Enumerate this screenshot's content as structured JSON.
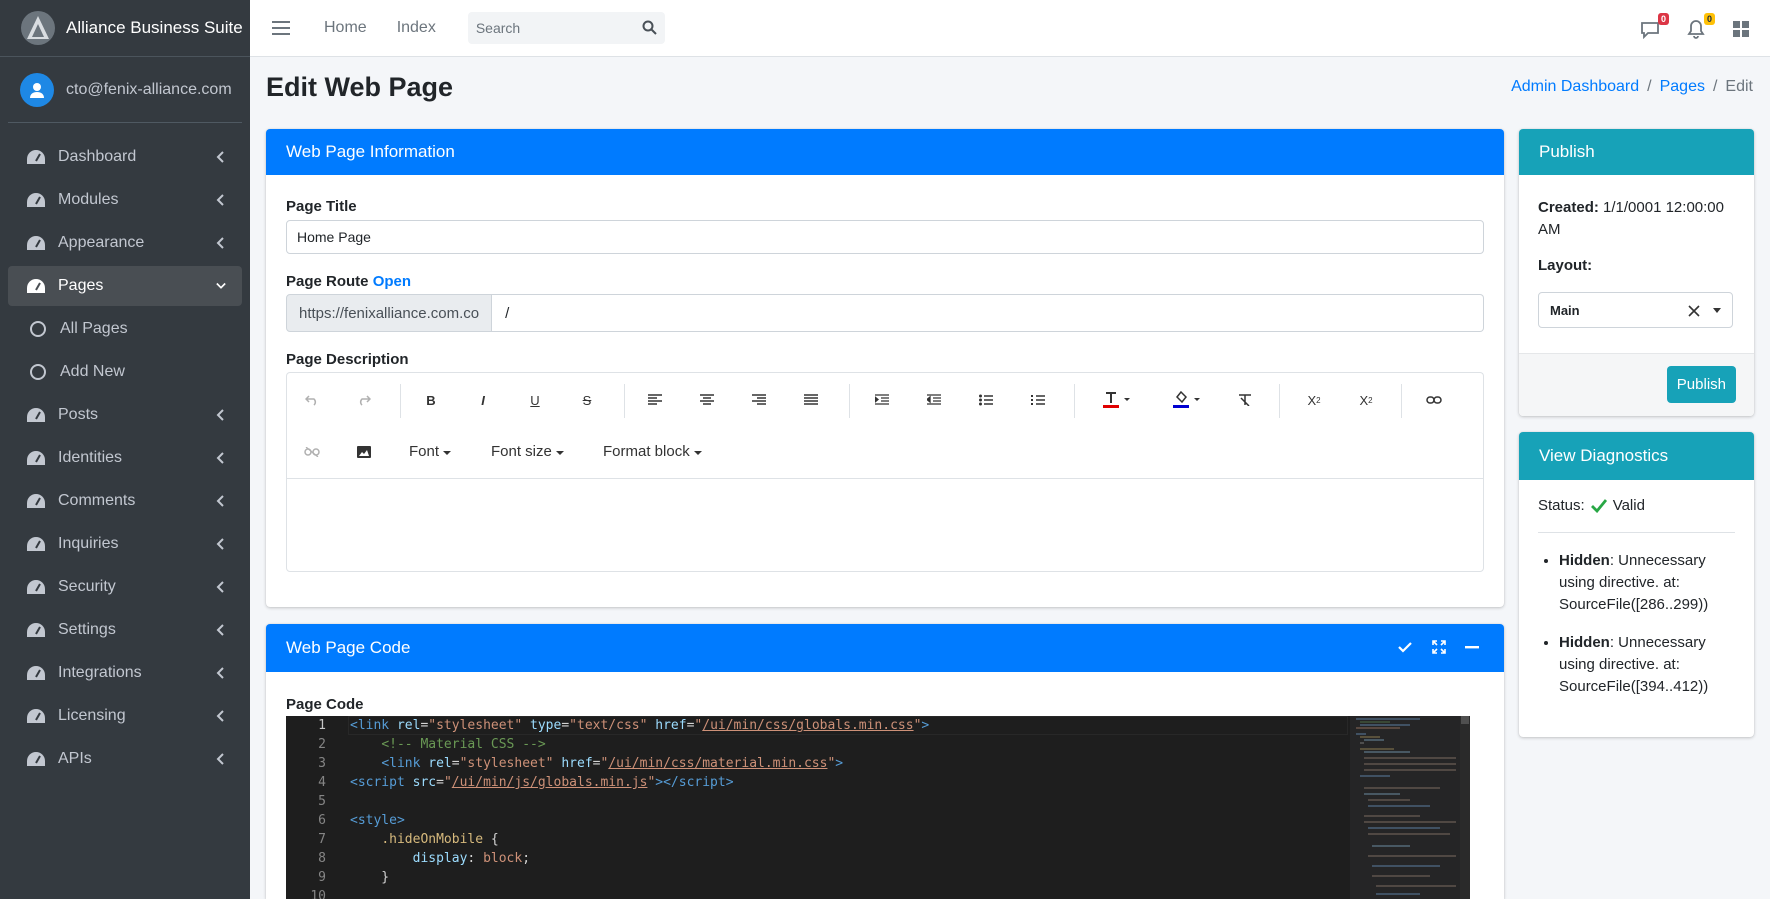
{
  "app": {
    "brand": "Alliance Business Suite",
    "user": "cto@fenix-alliance.com"
  },
  "sidebar": {
    "items": [
      {
        "label": "Dashboard",
        "icon": "gauge-icon"
      },
      {
        "label": "Modules",
        "icon": "gauge-icon"
      },
      {
        "label": "Appearance",
        "icon": "gauge-icon"
      },
      {
        "label": "Pages",
        "icon": "gauge-icon",
        "active": true
      },
      {
        "label": "All Pages",
        "icon": "circle-icon"
      },
      {
        "label": "Add New",
        "icon": "circle-icon"
      },
      {
        "label": "Posts",
        "icon": "gauge-icon"
      },
      {
        "label": "Identities",
        "icon": "gauge-icon"
      },
      {
        "label": "Comments",
        "icon": "gauge-icon"
      },
      {
        "label": "Inquiries",
        "icon": "gauge-icon"
      },
      {
        "label": "Security",
        "icon": "gauge-icon"
      },
      {
        "label": "Settings",
        "icon": "gauge-icon"
      },
      {
        "label": "Integrations",
        "icon": "gauge-icon"
      },
      {
        "label": "Licensing",
        "icon": "gauge-icon"
      },
      {
        "label": "APIs",
        "icon": "gauge-icon"
      }
    ]
  },
  "topbar": {
    "home": "Home",
    "index": "Index",
    "search_placeholder": "Search",
    "messages_count": "0",
    "notifications_count": "0"
  },
  "page": {
    "title": "Edit Web Page",
    "breadcrumb": {
      "dashboard": "Admin Dashboard",
      "pages": "Pages",
      "current": "Edit"
    }
  },
  "info_card": {
    "header": "Web Page Information",
    "title_label": "Page Title",
    "title_value": "Home Page",
    "route_label": "Page Route",
    "route_open": "Open",
    "route_prefix": "https://fenixalliance.com.co",
    "route_value": "/",
    "description_label": "Page Description",
    "toolbar": {
      "font": "Font",
      "font_size": "Font size",
      "format_block": "Format block"
    }
  },
  "code_card": {
    "header": "Web Page Code",
    "code_label": "Page Code",
    "line_numbers": [
      "1",
      "2",
      "3",
      "4",
      "5",
      "6",
      "7",
      "8",
      "9",
      "10"
    ]
  },
  "publish_card": {
    "header": "Publish",
    "created_label": "Created:",
    "created_value": "1/1/0001 12:00:00 AM",
    "layout_label": "Layout:",
    "layout_value": "Main",
    "publish_button": "Publish"
  },
  "diagnostics_card": {
    "header": "View Diagnostics",
    "status_label": "Status:",
    "status_value": "Valid",
    "items": [
      {
        "kind": "Hidden",
        "text": ": Unnecessary using directive. at: SourceFile([286..299))"
      },
      {
        "kind": "Hidden",
        "text": ": Unnecessary using directive. at: SourceFile([394..412))"
      }
    ]
  },
  "colors": {
    "primary": "#007bff",
    "info": "#17a2b8",
    "sidebar": "#343a40",
    "badge_danger": "#dc3545",
    "badge_warning": "#ffc107"
  }
}
